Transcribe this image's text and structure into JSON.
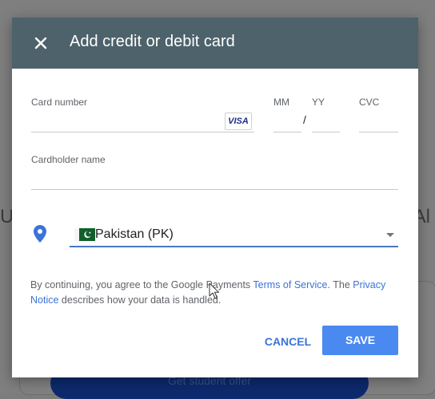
{
  "background": {
    "left_fragment": "Ur",
    "right_fragment": "Al",
    "cta_button_label": "Get student offer"
  },
  "dialog": {
    "title": "Add credit or debit card",
    "card_number": {
      "label": "Card number",
      "value": ""
    },
    "expiry": {
      "month_label": "MM",
      "year_label": "YY",
      "separator": "/",
      "month_value": "",
      "year_value": ""
    },
    "cvc": {
      "label": "CVC",
      "value": ""
    },
    "card_brand": "VISA",
    "cardholder": {
      "label": "Cardholder name",
      "value": ""
    },
    "country": {
      "selected": "Pakistan (PK)"
    },
    "terms": {
      "prefix": "By continuing, you agree to the Google Payments ",
      "terms_link": "Terms of Service",
      "middle": ". The ",
      "privacy_link": "Privacy Notice",
      "suffix": " describes how your data is handled."
    },
    "buttons": {
      "cancel": "CANCEL",
      "save": "SAVE"
    }
  },
  "colors": {
    "header": "#4d626b",
    "accent": "#4a89f0",
    "link": "#3b73d9",
    "overlay": "#7f7f7f"
  }
}
